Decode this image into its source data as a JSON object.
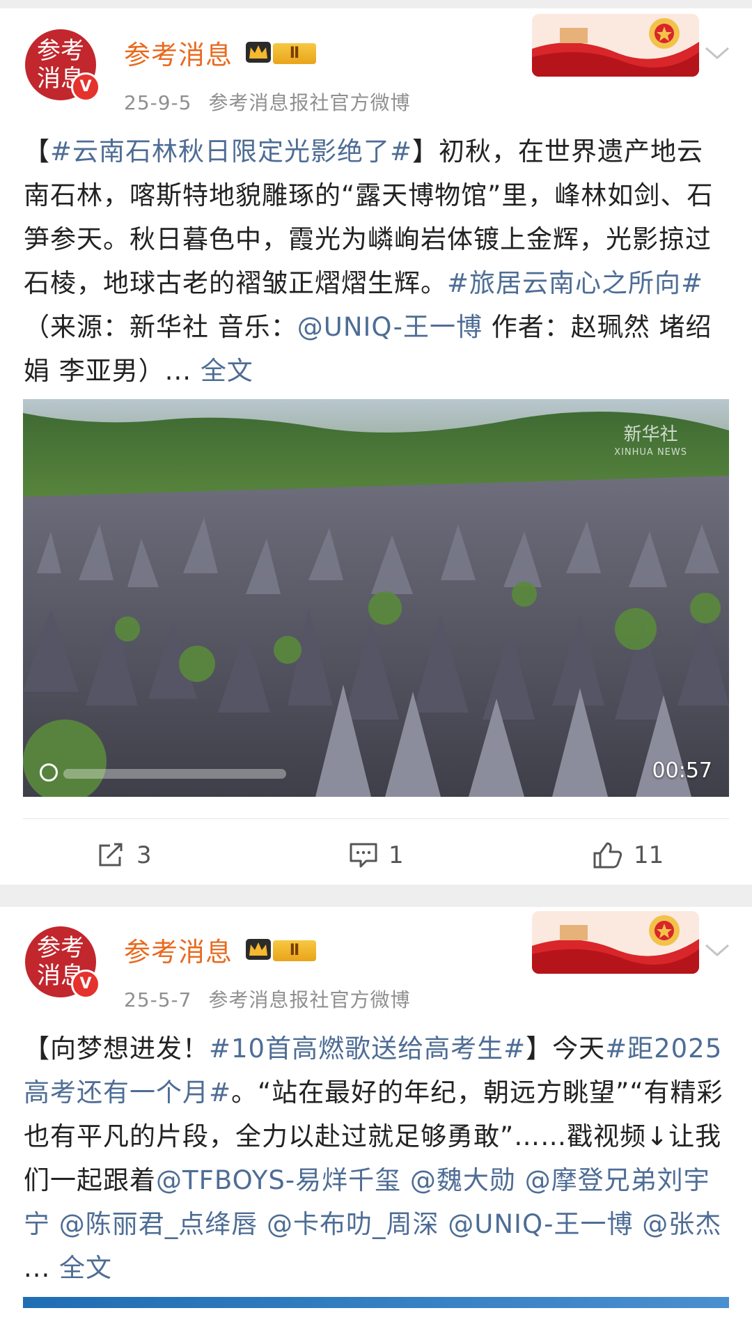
{
  "posts": [
    {
      "author": "参考消息",
      "avatar_text": "参考消息",
      "rank_badge": "Ⅱ",
      "verified_mark": "V",
      "date": "25-9-5",
      "source": "参考消息报社官方微博",
      "text_segments": [
        {
          "t": "【",
          "tag": false
        },
        {
          "t": "#云南石林秋日限定光影绝了#",
          "tag": true
        },
        {
          "t": "】初秋，在世界遗产地云南石林，喀斯特地貌雕琢的“露天博物馆”里，峰林如剑、石笋参天。秋日暮色中，霞光为嶙峋岩体镀上金辉，光影掠过石棱，地球古老的褶皱正熠熠生辉。",
          "tag": false
        },
        {
          "t": "#旅居云南心之所向#",
          "tag": true
        },
        {
          "t": "（来源：新华社 音乐：",
          "tag": false
        },
        {
          "t": "@UNIQ-王一博",
          "tag": true
        },
        {
          "t": " 作者：赵珮然 堵绍娟 李亚男）... ",
          "tag": false
        },
        {
          "t": "全文",
          "tag": true
        }
      ],
      "video": {
        "watermark": "新华社",
        "watermark_sub": "XINHUA NEWS",
        "duration": "00:57"
      },
      "actions": {
        "repost_count": "3",
        "comment_count": "1",
        "like_count": "11"
      }
    },
    {
      "author": "参考消息",
      "avatar_text": "参考消息",
      "rank_badge": "Ⅱ",
      "verified_mark": "V",
      "date": "25-5-7",
      "source": "参考消息报社官方微博",
      "text_segments": [
        {
          "t": "【向梦想进发！",
          "tag": false
        },
        {
          "t": "#10首高燃歌送给高考生#",
          "tag": true
        },
        {
          "t": "】今天",
          "tag": false
        },
        {
          "t": "#距2025高考还有一个月#",
          "tag": true
        },
        {
          "t": "。“站在最好的年纪，朝远方眺望”“有精彩也有平凡的片段，全力以赴过就足够勇敢”……戳视频↓让我们一起跟着",
          "tag": false
        },
        {
          "t": "@TFBOYS-易烊千玺",
          "tag": true
        },
        {
          "t": " ",
          "tag": false
        },
        {
          "t": "@魏大勋",
          "tag": true
        },
        {
          "t": " ",
          "tag": false
        },
        {
          "t": "@摩登兄弟刘宇宁",
          "tag": true
        },
        {
          "t": " ",
          "tag": false
        },
        {
          "t": "@陈丽君_点绛唇",
          "tag": true
        },
        {
          "t": " ",
          "tag": false
        },
        {
          "t": "@卡布叻_周深",
          "tag": true
        },
        {
          "t": " ",
          "tag": false
        },
        {
          "t": "@UNIQ-王一博",
          "tag": true
        },
        {
          "t": " ",
          "tag": false
        },
        {
          "t": "@张杰",
          "tag": true
        },
        {
          "t": " ... ",
          "tag": false
        },
        {
          "t": "全文",
          "tag": true
        }
      ]
    }
  ],
  "colors": {
    "author": "#e86b1f",
    "link": "#4e6d95",
    "avatar": "#c1272d",
    "page_bg": "#eeeeee"
  },
  "icons": [
    "repost-icon",
    "comment-icon",
    "like-icon",
    "chevron-down-icon",
    "crown-icon"
  ]
}
